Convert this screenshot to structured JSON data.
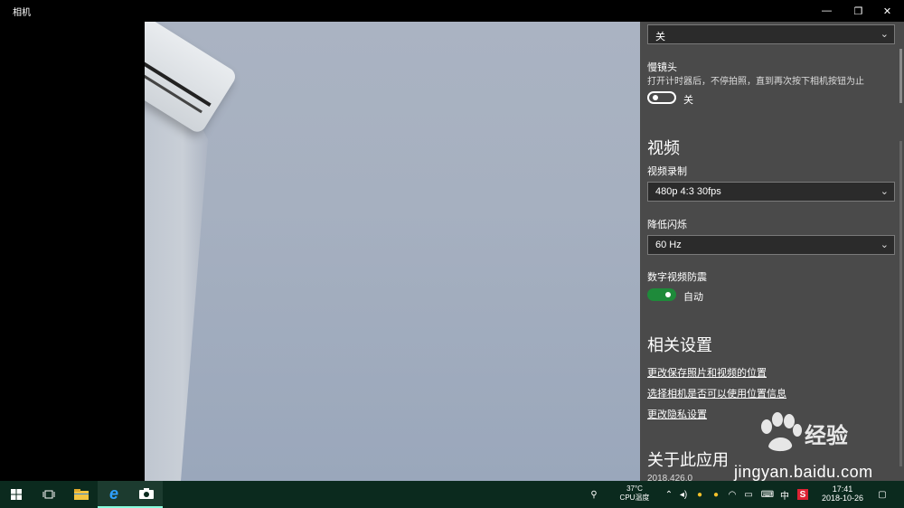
{
  "window": {
    "title": "相机",
    "controls": {
      "minimize": "—",
      "restore": "❐",
      "close": "✕"
    }
  },
  "panel": {
    "top_select": {
      "value": "关"
    },
    "timelapse": {
      "title": "慢镜头",
      "description": "打开计时器后，不停拍照，直到再次按下相机按钮为止",
      "state_label": "关"
    },
    "video_section": {
      "heading": "视频",
      "recording_label": "视频录制",
      "recording_value": "480p 4:3 30fps",
      "flicker_label": "降低闪烁",
      "flicker_value": "60 Hz",
      "stabilization_label": "数字视频防震",
      "stabilization_state": "自动"
    },
    "related_section": {
      "heading": "相关设置",
      "links": [
        "更改保存照片和视频的位置",
        "选择相机是否可以使用位置信息",
        "更改隐私设置"
      ]
    },
    "about_section": {
      "heading": "关于此应用",
      "version_partial": "2018.426.0"
    }
  },
  "watermark": {
    "brand": "经验",
    "site": "jingyan.baidu.com"
  },
  "taskbar": {
    "temp": "37°C",
    "temp_label": "CPU温度",
    "ime": "中",
    "time": "17:41",
    "date": "2018-10-26"
  },
  "colors": {
    "panel_bg": "#4a4a4a",
    "toggle_on": "#1e8a3a",
    "taskbar_bg": "#0b2a1e"
  }
}
